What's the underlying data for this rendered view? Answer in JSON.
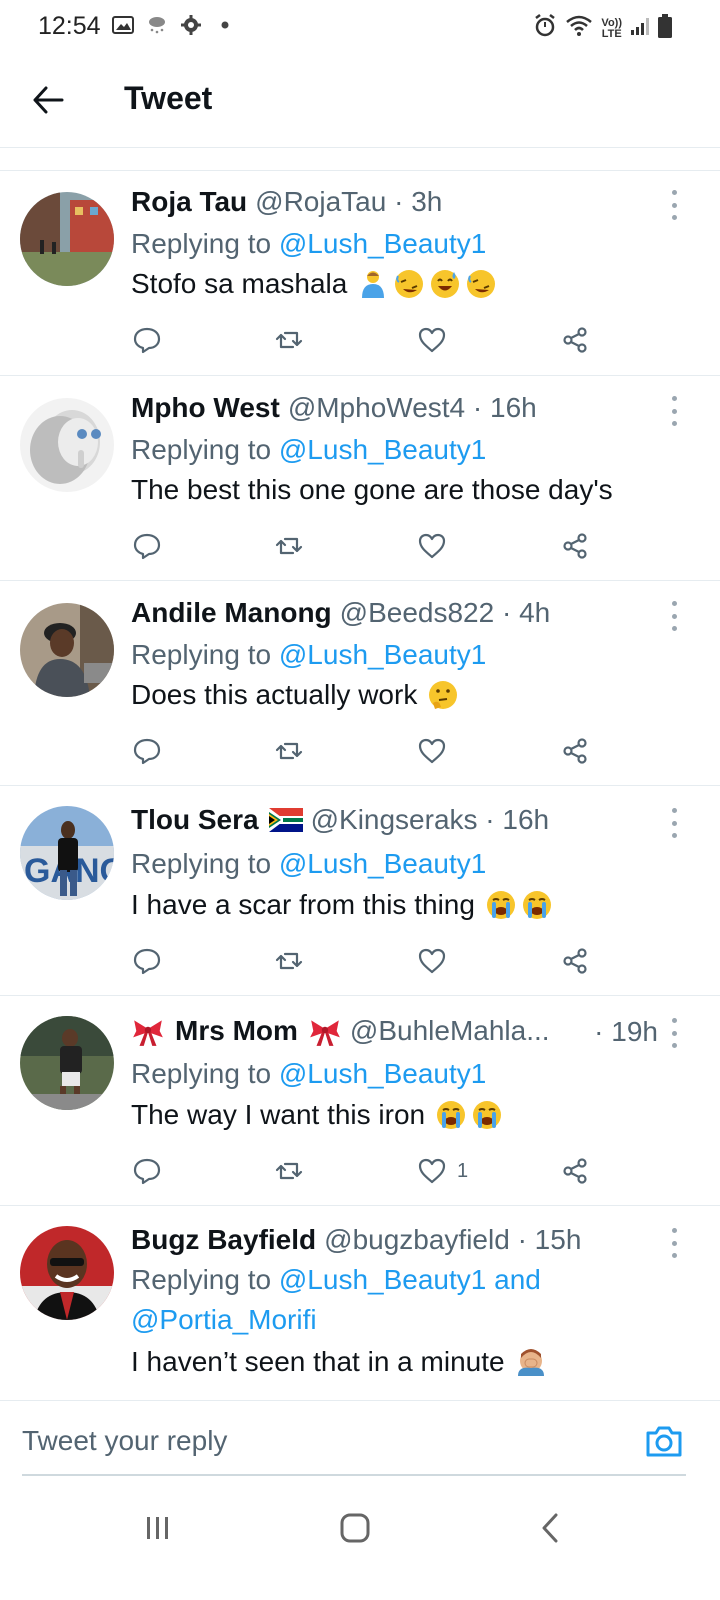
{
  "status_bar": {
    "time": "12:54",
    "lte": [
      "Vo))",
      "LTE"
    ]
  },
  "header": {
    "title": "Tweet"
  },
  "replying_prefix": "Replying to",
  "tweets": [
    {
      "name": "Roja Tau",
      "handle": "@RojaTau · 3h",
      "replying": "@Lush_Beauty1",
      "text": "Stofo sa mashala",
      "emojis": [
        "man-icon",
        "rofl-icon",
        "sweat-smile-icon",
        "rofl-icon"
      ],
      "likes": ""
    },
    {
      "name": "Mpho West",
      "handle": "@MphoWest4 · 16h",
      "replying": "@Lush_Beauty1",
      "text": "The best this one gone are those day's",
      "emojis": [],
      "likes": ""
    },
    {
      "name": "Andile Manong",
      "handle": "@Beeds822 · 4h",
      "replying": "@Lush_Beauty1",
      "text": "Does this actually work",
      "emojis": [
        "thinking-icon"
      ],
      "likes": ""
    },
    {
      "name": "Tlou Sera",
      "handle": "@Kingseraks · 16h",
      "replying": "@Lush_Beauty1",
      "text": "I have a scar from this thing",
      "emojis": [
        "crying-icon",
        "crying-icon"
      ],
      "likes": ""
    },
    {
      "name": "Mrs Mom",
      "handle": "@BuhleMahla...",
      "time": "· 19h",
      "replying": "@Lush_Beauty1",
      "text": "The way I want this iron",
      "emojis": [
        "crying-icon",
        "crying-icon"
      ],
      "likes": "1"
    },
    {
      "name": "Bugz Bayfield",
      "handle": "@bugzbayfield · 15h",
      "replying": "@Lush_Beauty1",
      "and": "and",
      "replying2": "@Portia_Morifi",
      "text": "I haven’t seen that in a minute",
      "emojis": [
        "facepalm-icon"
      ],
      "likes": ""
    }
  ],
  "reply_bar": {
    "placeholder": "Tweet your reply"
  },
  "colors": {
    "link": "#1d9bf0",
    "secondary": "#536471",
    "text": "#0f1419"
  }
}
